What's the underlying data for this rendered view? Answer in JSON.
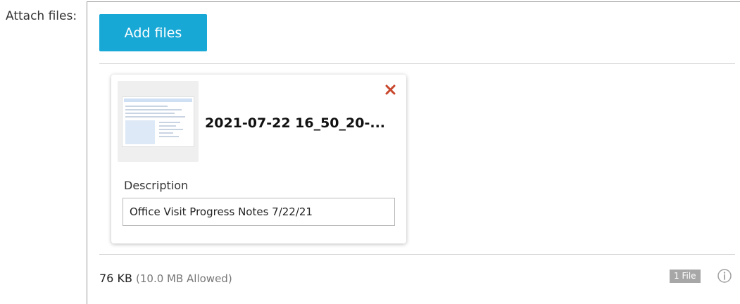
{
  "field": {
    "label": "Attach files:"
  },
  "toolbar": {
    "add_files_label": "Add files"
  },
  "file": {
    "name": "2021-07-22 16_50_20-...",
    "remove_icon": "close-icon",
    "description_label": "Description",
    "description_value": "Office Visit Progress Notes 7/22/21"
  },
  "footer": {
    "size": "76 KB",
    "allowed": "(10.0 MB Allowed)",
    "count_badge": "1 File",
    "info_icon": "info-icon"
  },
  "colors": {
    "button": "#17a8d6",
    "remove": "#c8472d",
    "badge": "#a7a7a7"
  }
}
